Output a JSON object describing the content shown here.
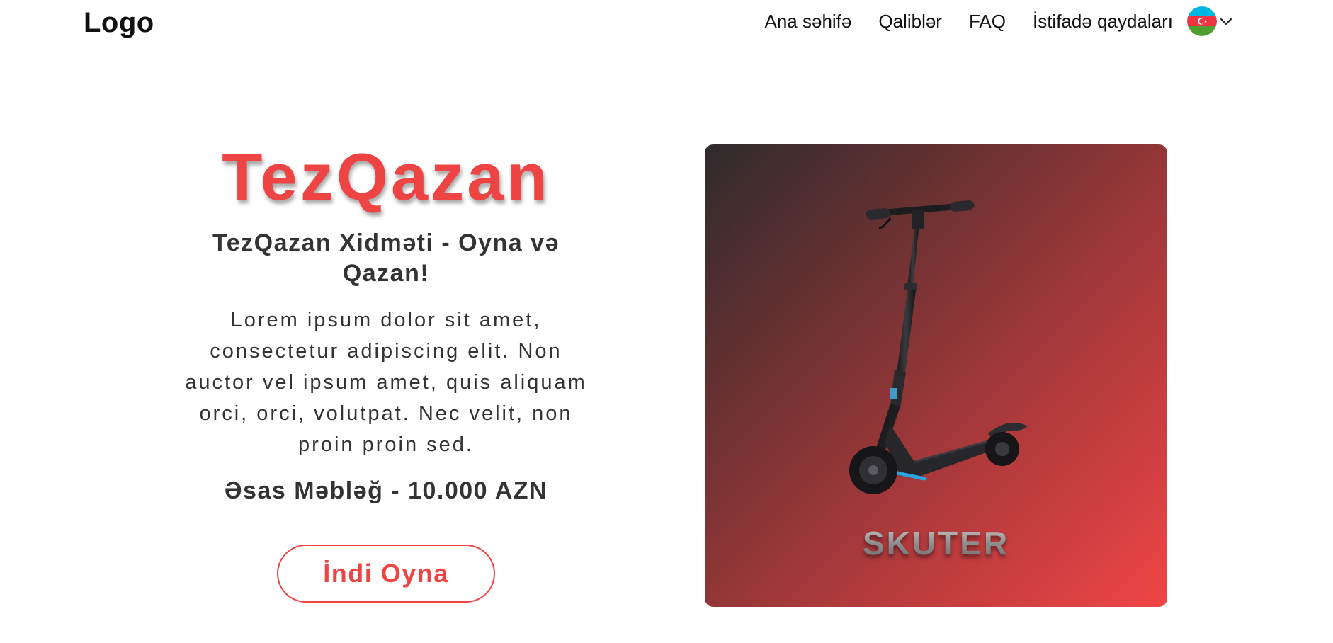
{
  "header": {
    "logo": "Logo",
    "nav": [
      "Ana səhifə",
      "Qaliblər",
      "FAQ",
      "İstifadə qaydaları"
    ],
    "language_icon": "azerbaijan-flag-icon",
    "dropdown_icon": "chevron-down-icon"
  },
  "hero": {
    "brand": "TezQazan",
    "subtitle": "TezQazan Xidməti - Oyna və Qazan!",
    "description": "Lorem ipsum dolor sit amet, consectetur adipiscing elit. Non auctor vel ipsum amet, quis aliquam orci, orci, volutpat. Nec velit, non proin proin sed.",
    "amount": "Əsas Məbləğ - 10.000 AZN",
    "cta": "İndi Oyna"
  },
  "prize": {
    "label": "SKUTER",
    "image": "electric-scooter"
  },
  "colors": {
    "accent": "#ef4444",
    "text": "#333333",
    "card_gradient_start": "#2e2b2d",
    "card_gradient_end": "#f04546"
  }
}
